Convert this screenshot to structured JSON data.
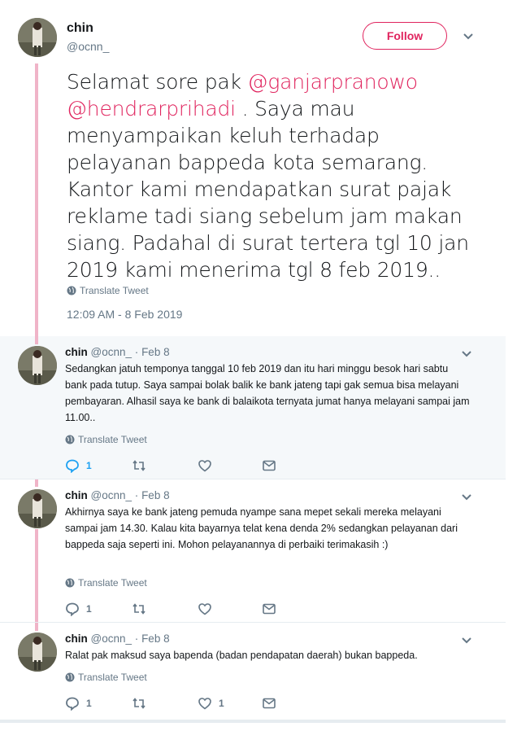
{
  "main_tweet": {
    "name": "chin",
    "handle": "@ocnn_",
    "follow_label": "Follow",
    "text_parts": [
      {
        "text": "Selamat sore pak "
      },
      {
        "text": "@ganjarpranowo",
        "mention": true
      },
      {
        "text": " "
      },
      {
        "text": "@hendrarprihadi",
        "mention": true
      },
      {
        "text": " . Saya mau menyampaikan keluh terhadap pelayanan bappeda kota semarang. Kantor kami mendapatkan surat pajak reklame tadi siang sebelum jam makan siang. Padahal di surat tertera tgl 10 jan 2019 kami menerima tgl 8 feb 2019.."
      }
    ],
    "translate_label": "Translate Tweet",
    "timestamp": "12:09 AM - 8 Feb 2019"
  },
  "replies": [
    {
      "name": "chin",
      "handle": "@ocnn_",
      "sep": "·",
      "date": "Feb 8",
      "text": "Sedangkan jatuh temponya tanggal 10 feb 2019 dan itu hari minggu besok hari sabtu bank pada tutup. Saya sampai bolak balik ke bank jateng tapi gak semua bisa melayani pembayaran. Alhasil saya ke bank di balaikota ternyata jumat hanya melayani sampai jam 11.00..",
      "translate_label": "Translate Tweet",
      "reply_count": "1",
      "like_count": ""
    },
    {
      "name": "chin",
      "handle": "@ocnn_",
      "sep": "·",
      "date": "Feb 8",
      "text": "Akhirnya saya ke bank jateng pemuda nyampe sana mepet sekali mereka melayani sampai jam 14.30. Kalau kita bayarnya telat kena denda 2% sedangkan pelayanan dari bappeda saja seperti ini. Mohon pelayanannya di perbaiki terimakasih :)",
      "translate_label": "Translate Tweet",
      "reply_count": "1",
      "like_count": ""
    },
    {
      "name": "chin",
      "handle": "@ocnn_",
      "sep": "·",
      "date": "Feb 8",
      "text": "Ralat pak maksud saya bapenda (badan pendapatan daerah) bukan bappeda.",
      "translate_label": "Translate Tweet",
      "reply_count": "1",
      "like_count": "1"
    }
  ],
  "colors": {
    "accent": "#e0245e",
    "thread_line": "#f0b4c8",
    "reply_highlight": "#f5f8fa",
    "link_blue": "#1da1f2",
    "muted": "#657786"
  },
  "icons": [
    "globe-icon",
    "reply-icon",
    "retweet-icon",
    "like-icon",
    "message-icon",
    "chevron-down-icon"
  ]
}
